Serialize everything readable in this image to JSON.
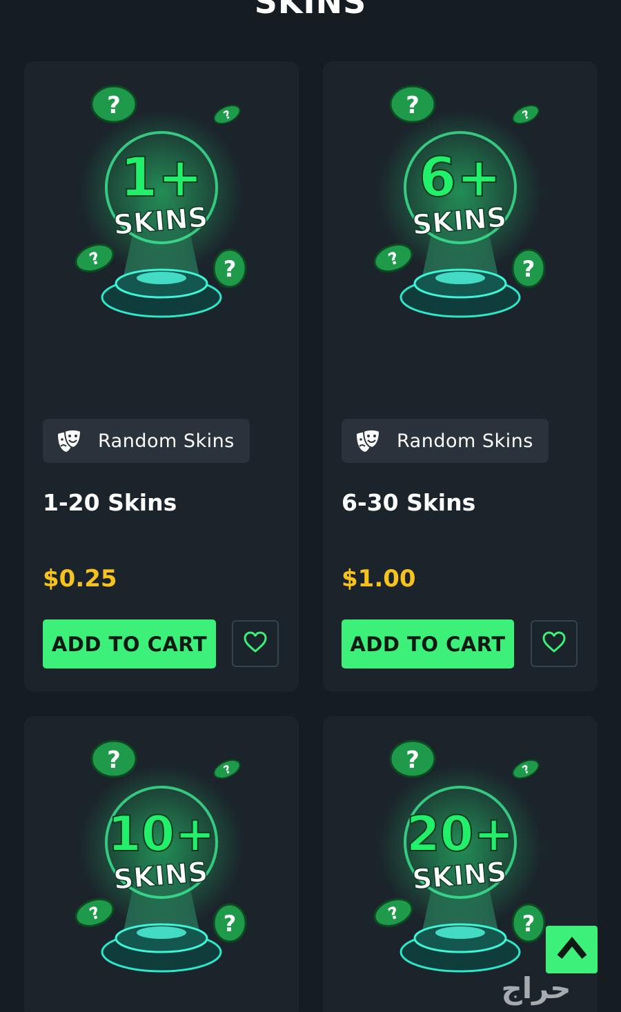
{
  "section": {
    "title": "SKINS"
  },
  "products": [
    {
      "badge_number": "1+",
      "badge_word": "SKINS",
      "category": "Random Skins",
      "name": "1-20 Skins",
      "price": "$0.25",
      "cta": "ADD TO CART"
    },
    {
      "badge_number": "6+",
      "badge_word": "SKINS",
      "category": "Random Skins",
      "name": "6-30 Skins",
      "price": "$1.00",
      "cta": "ADD TO CART"
    },
    {
      "badge_number": "10+",
      "badge_word": "SKINS"
    },
    {
      "badge_number": "20+",
      "badge_word": "SKINS"
    }
  ],
  "colors": {
    "background": "#151c22",
    "card": "#1b232b",
    "accent_green": "#3cf079",
    "price_yellow": "#f6c21f",
    "chip": "#2a333c"
  },
  "icons": {
    "category": "theater-masks-icon",
    "wishlist": "heart-icon",
    "scroll_top": "chevron-up-icon"
  },
  "watermark": {
    "text": "حراج"
  }
}
